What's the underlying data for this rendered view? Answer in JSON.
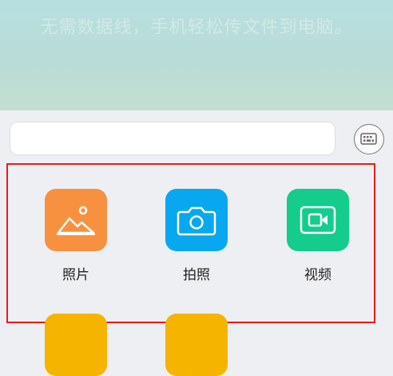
{
  "header": {
    "tagline": "无需数据线，手机轻松传文件到电脑。"
  },
  "input": {
    "value": "",
    "placeholder": ""
  },
  "keyboard_button": {
    "icon": "keyboard-toggle-icon"
  },
  "actions": [
    {
      "label": "照片",
      "icon": "picture-icon",
      "color": "#f79140"
    },
    {
      "label": "拍照",
      "icon": "camera-icon",
      "color": "#07a8ef"
    },
    {
      "label": "视频",
      "icon": "video-icon",
      "color": "#14cc8c"
    }
  ],
  "more_tiles_colors": [
    "#f5b400",
    "#f5b400"
  ],
  "highlight_color": "#e61c1c"
}
